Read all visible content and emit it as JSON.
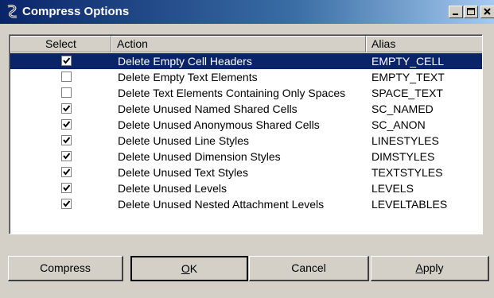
{
  "window": {
    "title": "Compress Options"
  },
  "columns": {
    "select": "Select",
    "action": "Action",
    "alias": "Alias"
  },
  "rows": [
    {
      "checked": true,
      "action": "Delete Empty Cell Headers",
      "alias": "EMPTY_CELL",
      "selected": true
    },
    {
      "checked": false,
      "action": "Delete Empty Text Elements",
      "alias": "EMPTY_TEXT",
      "selected": false
    },
    {
      "checked": false,
      "action": "Delete Text Elements Containing Only Spaces",
      "alias": "SPACE_TEXT",
      "selected": false
    },
    {
      "checked": true,
      "action": "Delete Unused Named Shared Cells",
      "alias": "SC_NAMED",
      "selected": false
    },
    {
      "checked": true,
      "action": "Delete Unused Anonymous Shared Cells",
      "alias": "SC_ANON",
      "selected": false
    },
    {
      "checked": true,
      "action": "Delete Unused Line Styles",
      "alias": "LINESTYLES",
      "selected": false
    },
    {
      "checked": true,
      "action": "Delete Unused Dimension Styles",
      "alias": "DIMSTYLES",
      "selected": false
    },
    {
      "checked": true,
      "action": "Delete Unused Text Styles",
      "alias": "TEXTSTYLES",
      "selected": false
    },
    {
      "checked": true,
      "action": "Delete Unused Levels",
      "alias": "LEVELS",
      "selected": false
    },
    {
      "checked": true,
      "action": "Delete Unused Nested Attachment Levels",
      "alias": "LEVELTABLES",
      "selected": false
    }
  ],
  "buttons": {
    "compress": "Compress",
    "ok_mnemonic": "O",
    "ok_rest": "K",
    "cancel": "Cancel",
    "apply_mnemonic": "A",
    "apply_rest": "pply"
  },
  "icons": {
    "app": "microstation-icon",
    "min": "minimize-icon",
    "max": "maximize-icon",
    "close": "close-icon"
  },
  "colors": {
    "titlebar": "#0a246a",
    "selection": "#0a246a",
    "face": "#d4d0c8"
  }
}
